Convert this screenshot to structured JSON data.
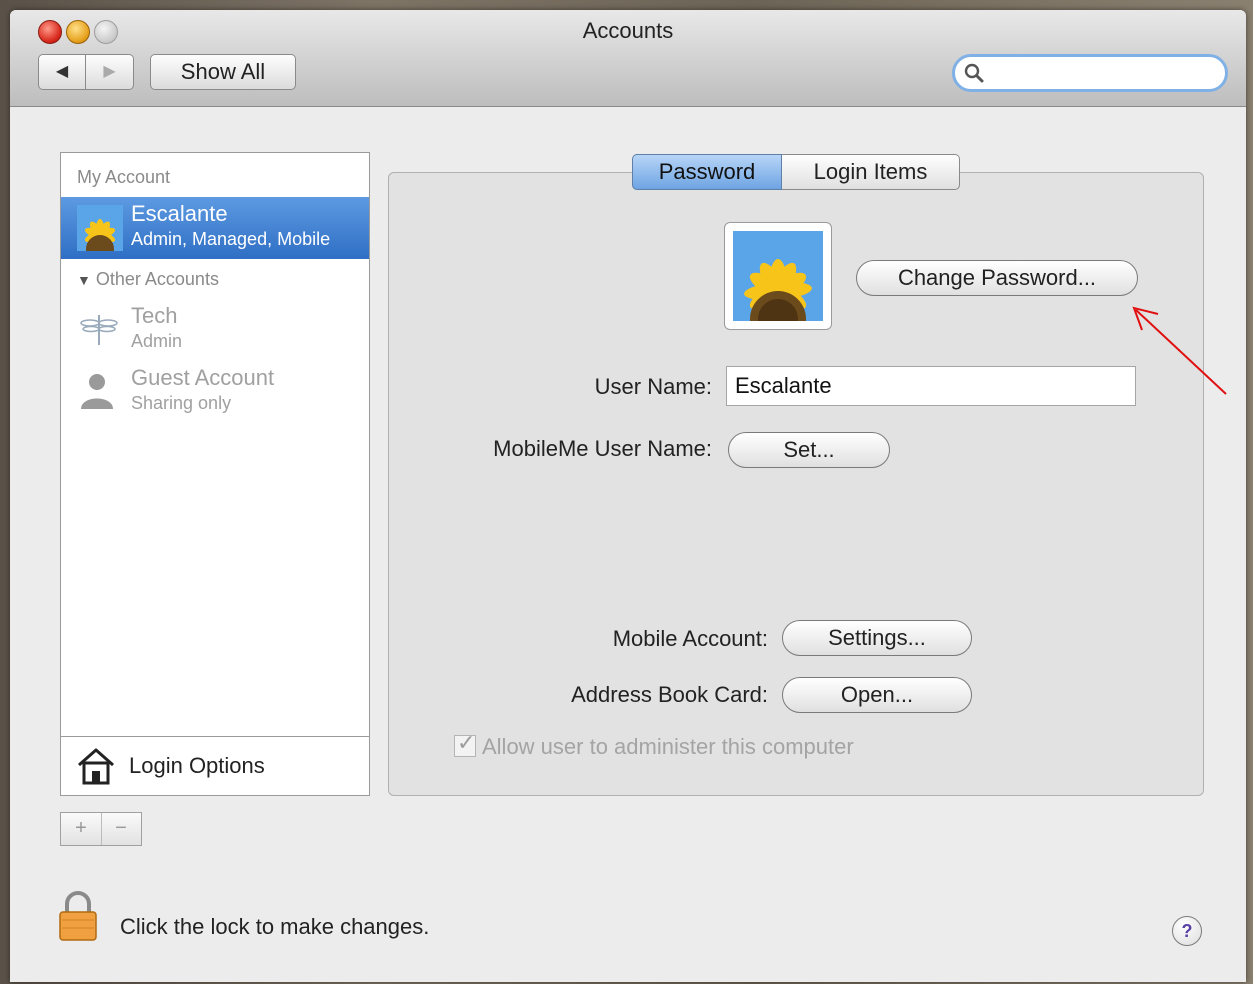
{
  "window": {
    "title": "Accounts"
  },
  "toolbar": {
    "back_glyph": "◀",
    "forward_glyph": "▶",
    "show_all_label": "Show All",
    "search_value": ""
  },
  "sidebar": {
    "my_account_header": "My Account",
    "my_account": {
      "name": "Escalante",
      "detail": "Admin, Managed, Mobile"
    },
    "other_accounts_header": "Other Accounts",
    "other_accounts": [
      {
        "name": "Tech",
        "detail": "Admin",
        "icon": "dragonfly-icon"
      },
      {
        "name": "Guest Account",
        "detail": "Sharing only",
        "icon": "person-silhouette-icon"
      }
    ],
    "login_options_label": "Login Options",
    "add_glyph": "+",
    "remove_glyph": "−"
  },
  "tabs": {
    "password": "Password",
    "login_items": "Login Items"
  },
  "panel": {
    "change_password_label": "Change Password...",
    "user_name_label": "User Name:",
    "user_name_value": "Escalante",
    "mobileme_label": "MobileMe User Name:",
    "mobileme_button": "Set...",
    "mobile_account_label": "Mobile Account:",
    "mobile_account_button": "Settings...",
    "address_book_label": "Address Book Card:",
    "address_book_button": "Open...",
    "allow_admin_label": "Allow user to administer this computer",
    "allow_admin_checked": true
  },
  "footer": {
    "lock_text": "Click the lock to make changes.",
    "help_glyph": "?"
  },
  "colors": {
    "selection": "#2f6fc4",
    "annotation_arrow": "#e01010",
    "help_glyph": "#5a3fa6"
  }
}
